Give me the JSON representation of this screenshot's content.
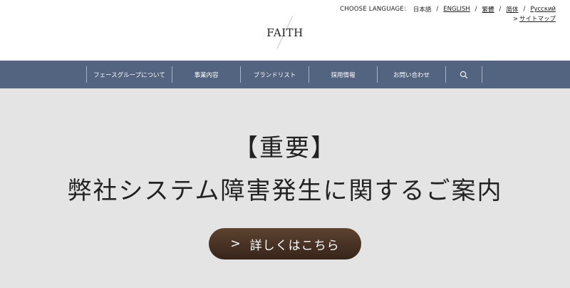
{
  "header": {
    "language_label": "CHOOSE LANGUAGE:",
    "languages": [
      {
        "label": "日本語"
      },
      {
        "label": "ENGLISH"
      },
      {
        "label": "繁體"
      },
      {
        "label": "简体"
      },
      {
        "label": "Русский"
      }
    ],
    "separator": "/",
    "sitemap_arrow": ">",
    "sitemap_label": "サイトマップ",
    "logo_text": "FAITH"
  },
  "nav": {
    "items": [
      {
        "label": "フェースグループについて"
      },
      {
        "label": "事業内容"
      },
      {
        "label": "ブランドリスト"
      },
      {
        "label": "採用情報"
      },
      {
        "label": "お問い合わせ"
      }
    ],
    "search_icon": "search-icon"
  },
  "hero": {
    "line1": "【重要】",
    "line2": "弊社システム障害発生に関するご案内",
    "cta_chevron": ">",
    "cta_label": "詳しくはこちら"
  },
  "colors": {
    "nav_bg": "#536480",
    "hero_bg": "#e4e4e4",
    "cta_bg": "#4a3324"
  }
}
